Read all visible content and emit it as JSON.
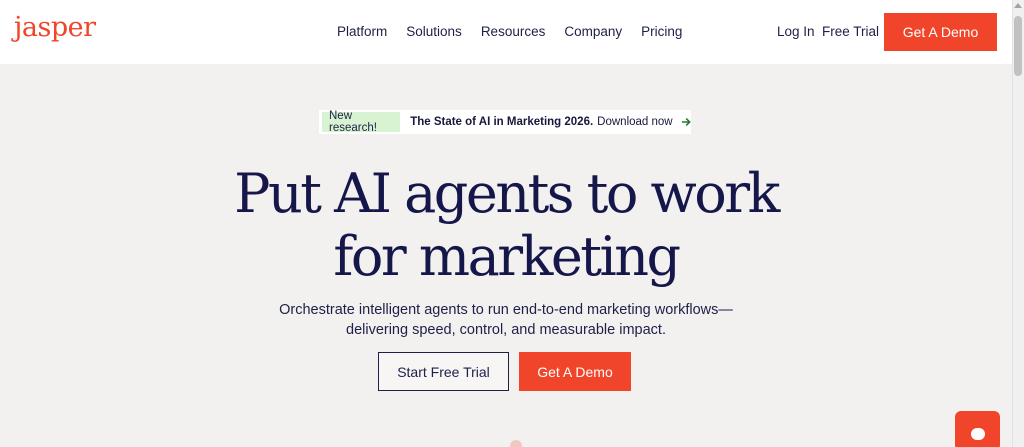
{
  "header": {
    "logo": "jasper",
    "nav": [
      "Platform",
      "Solutions",
      "Resources",
      "Company",
      "Pricing"
    ],
    "login": "Log In",
    "free_trial": "Free Trial",
    "demo_button": "Get A Demo"
  },
  "banner": {
    "badge": "New research!",
    "title": "The State of AI in Marketing 2026.",
    "link": "Download now",
    "arrow_icon": "arrow-right-icon"
  },
  "hero": {
    "title_line1": "Put AI agents to work",
    "title_line2": "for marketing",
    "subtitle_line1": "Orchestrate intelligent agents to run end-to-end marketing workflows—",
    "subtitle_line2": "delivering speed, control, and measurable impact.",
    "trial_button": "Start Free Trial",
    "demo_button": "Get A Demo"
  },
  "chat": {
    "icon": "chat-bubble-icon"
  },
  "colors": {
    "brand": "#f0452b",
    "navy": "#15174a",
    "badge_bg": "#d8f3d1",
    "hero_bg": "#f2f1f0"
  }
}
